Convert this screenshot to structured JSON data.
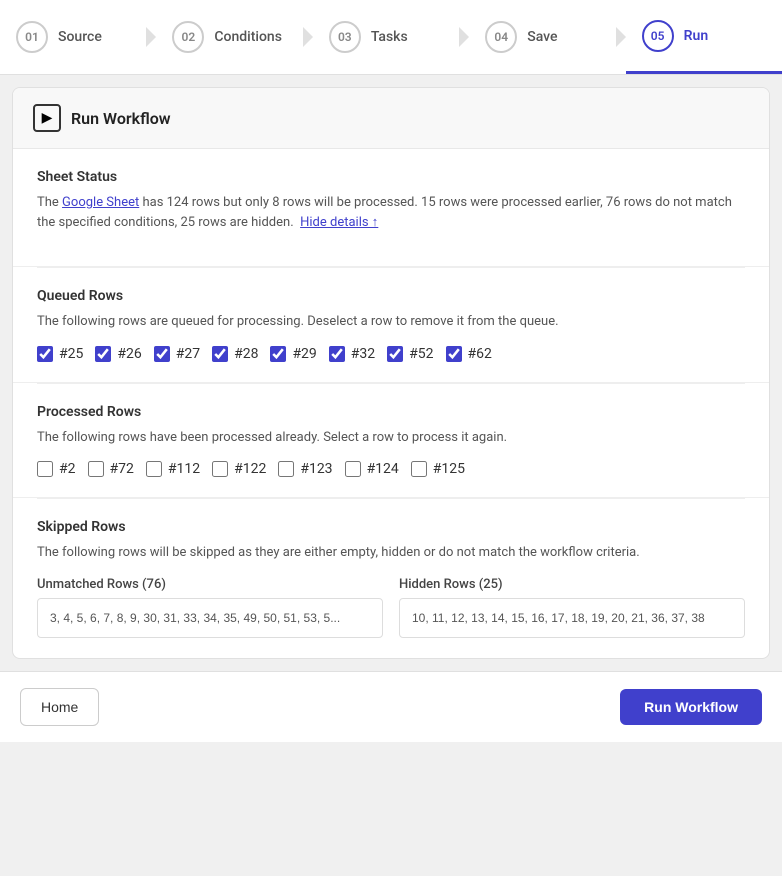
{
  "stepper": {
    "steps": [
      {
        "num": "01",
        "label": "Source",
        "active": false
      },
      {
        "num": "02",
        "label": "Conditions",
        "active": false
      },
      {
        "num": "03",
        "label": "Tasks",
        "active": false
      },
      {
        "num": "04",
        "label": "Save",
        "active": false
      },
      {
        "num": "05",
        "label": "Run",
        "active": true
      }
    ]
  },
  "panel": {
    "header_icon": "▶",
    "header_title": "Run Workflow",
    "sheet_status": {
      "title": "Sheet Status",
      "text_before_link": "The ",
      "link_text": "Google Sheet",
      "text_after_link": " has 124 rows but only 8 rows will be processed. 15 rows were processed earlier, 76 rows do not match the specified conditions, 25 rows are hidden.",
      "hide_details": "Hide details ↑"
    },
    "queued_rows": {
      "title": "Queued Rows",
      "description": "The following rows are queued for processing. Deselect a row to remove it from the queue.",
      "rows": [
        {
          "id": "#25",
          "checked": true
        },
        {
          "id": "#26",
          "checked": true
        },
        {
          "id": "#27",
          "checked": true
        },
        {
          "id": "#28",
          "checked": true
        },
        {
          "id": "#29",
          "checked": true
        },
        {
          "id": "#32",
          "checked": true
        },
        {
          "id": "#52",
          "checked": true
        },
        {
          "id": "#62",
          "checked": true
        }
      ]
    },
    "processed_rows": {
      "title": "Processed Rows",
      "description": "The following rows have been processed already. Select a row to process it again.",
      "rows": [
        {
          "id": "#2",
          "checked": false
        },
        {
          "id": "#72",
          "checked": false
        },
        {
          "id": "#112",
          "checked": false
        },
        {
          "id": "#122",
          "checked": false
        },
        {
          "id": "#123",
          "checked": false
        },
        {
          "id": "#124",
          "checked": false
        },
        {
          "id": "#125",
          "checked": false
        }
      ]
    },
    "skipped_rows": {
      "title": "Skipped Rows",
      "description": "The following rows will be skipped as they are either empty, hidden or do not match the workflow criteria.",
      "unmatched_label": "Unmatched Rows (76)",
      "unmatched_values": "3, 4, 5, 6, 7, 8, 9, 30, 31, 33, 34, 35, 49, 50, 51, 53, 5...",
      "hidden_label": "Hidden Rows (25)",
      "hidden_values": "10, 11, 12, 13, 14, 15, 16, 17, 18, 19, 20, 21, 36, 37, 38"
    },
    "footer": {
      "home_label": "Home",
      "run_label": "Run Workflow"
    }
  }
}
